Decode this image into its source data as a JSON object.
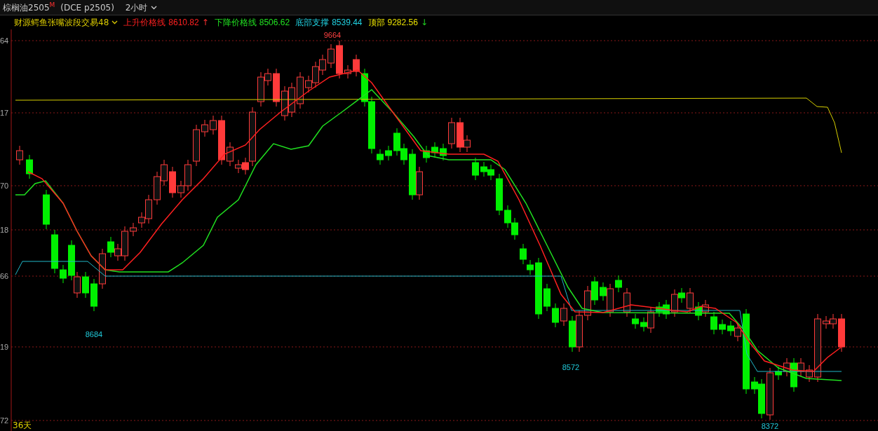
{
  "header": {
    "symbol": "棕榈油2505$^{M}$",
    "exchange": "(DCE p2505)",
    "period": "2小时"
  },
  "indicator": {
    "name": "财源鳄鱼张嘴波段交易48",
    "lines": [
      {
        "label": "上升价格线",
        "value": "8610.82",
        "arrow": "↑",
        "color": "#ff2020"
      },
      {
        "label": "下降价格线",
        "value": "8506.62",
        "color": "#20e020"
      },
      {
        "label": "底部支撑",
        "value": "8539.44",
        "color": "#20d0e0"
      },
      {
        "label": "顶部",
        "value": "9282.56",
        "arrow": "↓",
        "color": "#e8e000"
      }
    ]
  },
  "y_axis": [
    "64",
    "17",
    "70",
    "18",
    "66",
    "19",
    "72"
  ],
  "price_labels": [
    {
      "text": "9664",
      "kind": "high"
    },
    {
      "text": "8684",
      "kind": "low"
    },
    {
      "text": "8572",
      "kind": "low"
    },
    {
      "text": "8372",
      "kind": "low"
    }
  ],
  "footer": "36天"
}
